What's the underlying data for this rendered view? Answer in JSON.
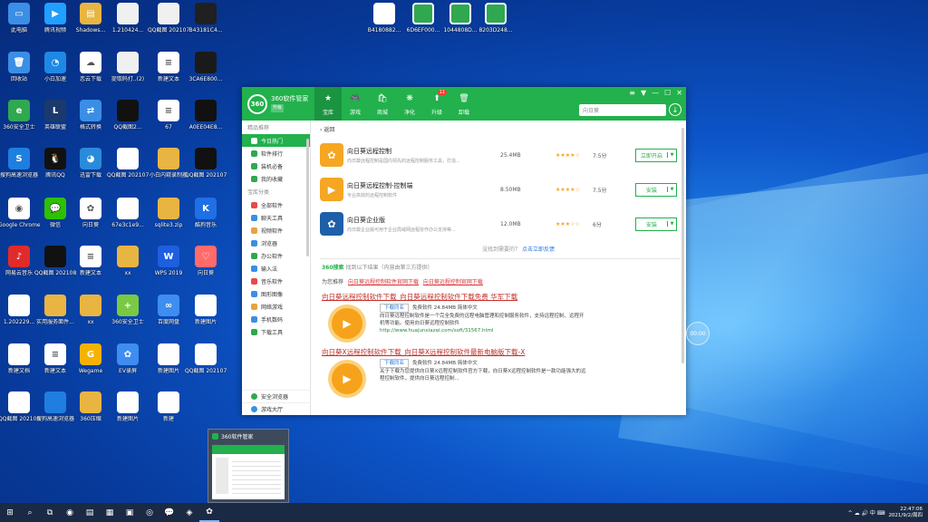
{
  "desktop_icons": [
    {
      "label": "此电脑",
      "color": "#3a8ee6",
      "glyph": "▭"
    },
    {
      "label": "腾讯视频",
      "color": "#21a0ff",
      "glyph": "▶"
    },
    {
      "label": "Shadows...",
      "color": "#e8b542",
      "glyph": "▤"
    },
    {
      "label": "1.210424...",
      "color": "#f0f0f0",
      "glyph": ""
    },
    {
      "label": "QQ截图 202107200...",
      "color": "#f0f0f0",
      "glyph": ""
    },
    {
      "label": "B43181C4...",
      "color": "#202020",
      "glyph": ""
    },
    {
      "label": "回收站",
      "color": "#3a8ee6",
      "glyph": "🗑"
    },
    {
      "label": "小白加速",
      "color": "#1e88e5",
      "glyph": "◔"
    },
    {
      "label": "恋云下载",
      "color": "#ffffff",
      "glyph": "☁"
    },
    {
      "label": "提取码打..(2)",
      "color": "#f0f0f0",
      "glyph": ""
    },
    {
      "label": "新建文本",
      "color": "#ffffff",
      "glyph": "≡"
    },
    {
      "label": "3CA6E800...",
      "color": "#1a1a1a",
      "glyph": ""
    },
    {
      "label": "360安全卫士",
      "color": "#2fa84f",
      "glyph": "e"
    },
    {
      "label": "英雄联盟",
      "color": "#1b3a6b",
      "glyph": "L"
    },
    {
      "label": "格式转换",
      "color": "#3a8ee6",
      "glyph": "⇄"
    },
    {
      "label": "QQ截图2...",
      "color": "#111111",
      "glyph": ""
    },
    {
      "label": "67",
      "color": "#ffffff",
      "glyph": "≡"
    },
    {
      "label": "A0EE04E8...",
      "color": "#111111",
      "glyph": ""
    },
    {
      "label": "搜狗高速浏览器",
      "color": "#1e7fe0",
      "glyph": "S"
    },
    {
      "label": "腾讯QQ",
      "color": "#111111",
      "glyph": "🐧"
    },
    {
      "label": "迅雷下载",
      "color": "#2a8bdb",
      "glyph": "◕"
    },
    {
      "label": "QQ截图 202107201...",
      "color": "#ffffff",
      "glyph": ""
    },
    {
      "label": "小白内窥录制器",
      "color": "#e8b542",
      "glyph": ""
    },
    {
      "label": "QQ截图 202107201...",
      "color": "#111111",
      "glyph": ""
    },
    {
      "label": "Google Chrome",
      "color": "#ffffff",
      "glyph": "◉"
    },
    {
      "label": "微信",
      "color": "#2dc100",
      "glyph": "💬"
    },
    {
      "label": "向日葵",
      "color": "#ffffff",
      "glyph": "✿"
    },
    {
      "label": "67e3c1e9...",
      "color": "#ffffff",
      "glyph": ""
    },
    {
      "label": "sqlite3.zip",
      "color": "#e8b542",
      "glyph": ""
    },
    {
      "label": "酷狗音乐",
      "color": "#1f6fe5",
      "glyph": "K"
    },
    {
      "label": "网易云音乐",
      "color": "#e02b2b",
      "glyph": "♪"
    },
    {
      "label": "QQ截图 202108200...",
      "color": "#111111",
      "glyph": ""
    },
    {
      "label": "新建文本",
      "color": "#ffffff",
      "glyph": "≡"
    },
    {
      "label": "xx",
      "color": "#e8b542",
      "glyph": ""
    },
    {
      "label": "WPS 2019",
      "color": "#1e5fe0",
      "glyph": "W"
    },
    {
      "label": "向日葵",
      "color": "#ff6b6b",
      "glyph": "♡"
    },
    {
      "label": "1.202229...",
      "color": "#ffffff",
      "glyph": ""
    },
    {
      "label": "实用服务面件...",
      "color": "#e8b542",
      "glyph": ""
    },
    {
      "label": "xx",
      "color": "#e8b542",
      "glyph": ""
    },
    {
      "label": "360安全卫士",
      "color": "#7ac943",
      "glyph": "+"
    },
    {
      "label": "百度网盘",
      "color": "#3d8ef0",
      "glyph": "∞"
    },
    {
      "label": "新建图片",
      "color": "#ffffff",
      "glyph": ""
    },
    {
      "label": "新建文档",
      "color": "#ffffff",
      "glyph": ""
    },
    {
      "label": "新建文本",
      "color": "#ffffff",
      "glyph": "≡"
    },
    {
      "label": "Wegame",
      "color": "#f5b300",
      "glyph": "G"
    },
    {
      "label": "EV录屏",
      "color": "#3d8ef0",
      "glyph": "✿"
    },
    {
      "label": "新建图片",
      "color": "#ffffff",
      "glyph": ""
    },
    {
      "label": "QQ截图 202107201...",
      "color": "#ffffff",
      "glyph": ""
    },
    {
      "label": "QQ截图 202108200...",
      "color": "#ffffff",
      "glyph": ""
    },
    {
      "label": "搜狗高速浏览器",
      "color": "#1e7fe0",
      "glyph": ""
    },
    {
      "label": "360压缩",
      "color": "#e8b542",
      "glyph": ""
    },
    {
      "label": "新建图片",
      "color": "#ffffff",
      "glyph": ""
    },
    {
      "label": "新建",
      "color": "#ffffff",
      "glyph": ""
    }
  ],
  "top_files": [
    {
      "label": "B4180882...",
      "color": "#ffffff"
    },
    {
      "label": "6D6EF000...",
      "color": "#2fa84f"
    },
    {
      "label": "1044808D...",
      "color": "#2fa84f"
    },
    {
      "label": "8203D248...",
      "color": "#2fa84f"
    }
  ],
  "window": {
    "brand_title": "360软件管家",
    "brand_sub": "升级",
    "tabs": [
      {
        "label": "宝库",
        "glyph": "★",
        "active": true
      },
      {
        "label": "游戏",
        "glyph": "🎮",
        "active": false
      },
      {
        "label": "商城",
        "glyph": "🛍",
        "active": false
      },
      {
        "label": "净化",
        "glyph": "❋",
        "active": false
      },
      {
        "label": "升级",
        "glyph": "⬆",
        "active": false,
        "badge": "11"
      },
      {
        "label": "卸载",
        "glyph": "🗑",
        "active": false
      }
    ],
    "controls": [
      "≡",
      "▼",
      "—",
      "☐",
      "✕"
    ],
    "search_placeholder": "向日葵",
    "download_icon": "↓",
    "sidebar": {
      "section1": "精品推荐",
      "items1": [
        {
          "label": "今日热门",
          "color": "#ffffff",
          "active": true
        },
        {
          "label": "软件排行",
          "color": "#2fa84f",
          "active": false
        },
        {
          "label": "装机必备",
          "color": "#2fa84f",
          "active": false
        },
        {
          "label": "我的收藏",
          "color": "#2fa84f",
          "active": false
        }
      ],
      "section2": "宝库分类",
      "items2": [
        {
          "label": "全部软件",
          "color": "#e84a4a"
        },
        {
          "label": "聊天工具",
          "color": "#3a8ee6"
        },
        {
          "label": "视频软件",
          "color": "#e8a242"
        },
        {
          "label": "浏览器",
          "color": "#3a8ee6"
        },
        {
          "label": "办公软件",
          "color": "#2fa84f"
        },
        {
          "label": "输入法",
          "color": "#3a8ee6"
        },
        {
          "label": "音乐软件",
          "color": "#e84a4a"
        },
        {
          "label": "图形图像",
          "color": "#3a8ee6"
        },
        {
          "label": "网络游戏",
          "color": "#e8a242"
        },
        {
          "label": "手机数码",
          "color": "#3a8ee6"
        },
        {
          "label": "下载工具",
          "color": "#2fa84f"
        }
      ],
      "bottom": [
        {
          "label": "安全浏览器",
          "color": "#2fa84f"
        },
        {
          "label": "游戏大厅",
          "color": "#3a8ee6"
        }
      ]
    },
    "back_label": "返回",
    "apps": [
      {
        "name": "向日葵远程控制",
        "desc": "向日葵远程控制是国内领先的远程控制服务工具，打造...",
        "size": "25.4MB",
        "stars": "★★★★☆",
        "score": "7.5分",
        "btn": "立即开启",
        "color": "#f5a623",
        "glyph": "✿"
      },
      {
        "name": "向日葵远程控制-控制端",
        "desc": "专业高效的远程控制软件",
        "size": "8.50MB",
        "stars": "★★★★☆",
        "score": "7.5分",
        "btn": "安装",
        "color": "#f5a623",
        "glyph": "▶"
      },
      {
        "name": "向日葵企业版",
        "desc": "向日葵企业版可用于企业局域网远程协作办公支持等...",
        "size": "12.0MB",
        "stars": "★★★☆☆",
        "score": "6分",
        "btn": "安装",
        "color": "#1e5fa8",
        "glyph": "✿"
      }
    ],
    "feedback_text": "没找到需要的？",
    "feedback_link": "点击立即反馈",
    "search_result_head_brand": "360搜索",
    "search_result_head_text": "找到以下结果（内容由第三方提供）",
    "recommend_label": "为您推荐",
    "recommend_links": [
      "向日葵远程控制软件官网下载",
      "向日葵远程控制官网下载"
    ],
    "results": [
      {
        "title": "向日葵远程控制软件下载_向日葵远程控制软件下载免费 华军下载",
        "dl": "下载同名",
        "meta": "免费软件 24.84MB 简体中文",
        "desc1": "向日葵远程控制软件是一个完全免费的远程电脑管理和控制服务软件，支持远程控制、远程开机等功能。使用向日葵远程控制软件",
        "url": "http://www.huajunxiazai.com/soft/31567.html"
      },
      {
        "title": "向日葵X远程控制软件下载_向日葵X远程控制软件最新电脑版下载-X",
        "dl": "下载同名",
        "meta": "免费软件 24.84MB 简体中文",
        "desc1": "关于下载为您提供向日葵X远程控制软件官方下载，向日葵X远程控制软件是一款功能强大的远程控制软件，提供向日葵远程控制...",
        "url": ""
      }
    ],
    "scroll_thumb": ""
  },
  "preview": {
    "title": "360软件管家"
  },
  "overlay_btn": "00:00",
  "taskbar": {
    "icons": [
      "⊞",
      "⌕",
      "⧉",
      "◉",
      "▤",
      "▦",
      "▣",
      "◎",
      "💬",
      "◈",
      "✿"
    ],
    "tray_icons": "^ ☁ 🔊 中 ⌨",
    "time": "22:47:06",
    "date": "2021/9/2/周四"
  }
}
